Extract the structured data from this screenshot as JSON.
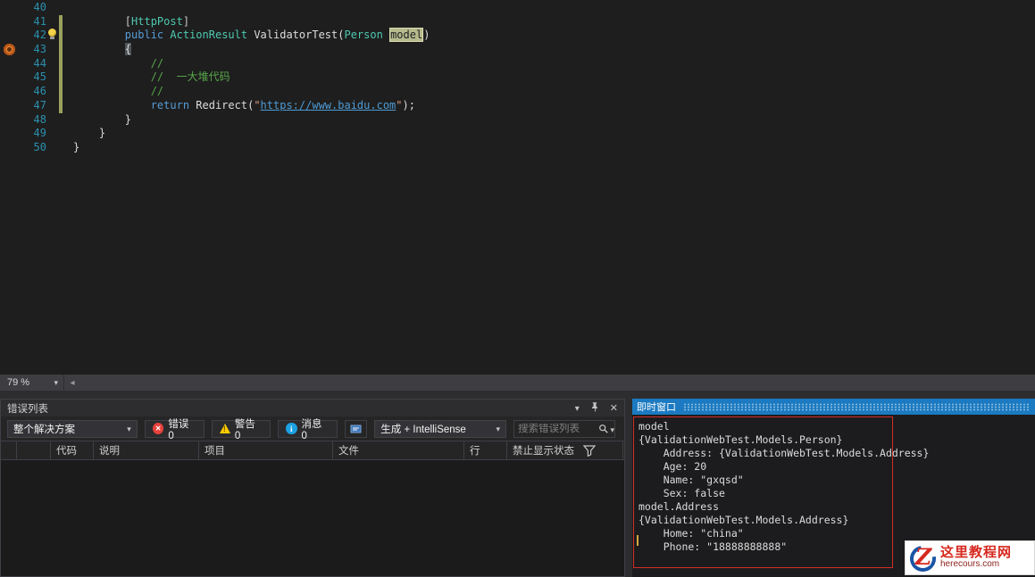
{
  "colors": {
    "accent_blue": "#1b7ac1",
    "annotation_red": "#d22d26",
    "error_red": "#e8413c",
    "warning_yellow": "#ffcc00",
    "info_blue": "#1ba1e2",
    "watermark_red": "#d6281e",
    "line_number_blue": "#2b91af",
    "keyword_blue": "#569cd6",
    "type_teal": "#4ec9b0",
    "comment_green": "#57a64a",
    "string_orange": "#d69d85"
  },
  "editor": {
    "zoom_label": "79 %",
    "lines": [
      {
        "num": "40",
        "indent": 0,
        "tokens": []
      },
      {
        "num": "41",
        "indent": 8,
        "tokens": [
          {
            "t": "punct",
            "s": "["
          },
          {
            "t": "type",
            "s": "HttpPost"
          },
          {
            "t": "punct",
            "s": "]"
          }
        ]
      },
      {
        "num": "42",
        "indent": 8,
        "tokens": [
          {
            "t": "kw",
            "s": "public"
          },
          {
            "t": "plain",
            "s": " "
          },
          {
            "t": "type",
            "s": "ActionResult"
          },
          {
            "t": "plain",
            "s": " ValidatorTest("
          },
          {
            "t": "type",
            "s": "Person"
          },
          {
            "t": "plain",
            "s": " "
          },
          {
            "t": "hl",
            "s": "model"
          },
          {
            "t": "plain",
            "s": ")"
          }
        ]
      },
      {
        "num": "43",
        "indent": 8,
        "tokens": [
          {
            "t": "bracehl",
            "s": "{"
          }
        ]
      },
      {
        "num": "44",
        "indent": 12,
        "tokens": [
          {
            "t": "comment",
            "s": "//"
          }
        ]
      },
      {
        "num": "45",
        "indent": 12,
        "tokens": [
          {
            "t": "comment",
            "s": "//  一大堆代码"
          }
        ]
      },
      {
        "num": "46",
        "indent": 12,
        "tokens": [
          {
            "t": "comment",
            "s": "//"
          }
        ]
      },
      {
        "num": "47",
        "indent": 12,
        "tokens": [
          {
            "t": "kw",
            "s": "return"
          },
          {
            "t": "plain",
            "s": " Redirect("
          },
          {
            "t": "str",
            "s": "\""
          },
          {
            "t": "link",
            "s": "https://www.baidu.com"
          },
          {
            "t": "str",
            "s": "\""
          },
          {
            "t": "plain",
            "s": ");"
          }
        ]
      },
      {
        "num": "48",
        "indent": 8,
        "tokens": [
          {
            "t": "plain",
            "s": "}"
          }
        ]
      },
      {
        "num": "49",
        "indent": 4,
        "tokens": [
          {
            "t": "plain",
            "s": "}"
          }
        ]
      },
      {
        "num": "50",
        "indent": 0,
        "tokens": [
          {
            "t": "plain",
            "s": "}"
          }
        ]
      }
    ]
  },
  "error_list": {
    "title": "错误列表",
    "scope_combo": "整个解决方案",
    "errors_button": "错误 0",
    "warnings_button": "警告 0",
    "messages_button": "消息 0",
    "filter_combo": "生成 + IntelliSense",
    "search_placeholder": "搜索错误列表",
    "columns": [
      "代码",
      "说明",
      "项目",
      "文件",
      "行",
      "禁止显示状态"
    ]
  },
  "immediate": {
    "title": "即时窗口",
    "lines": [
      "model",
      "{ValidationWebTest.Models.Person}",
      "    Address: {ValidationWebTest.Models.Address}",
      "    Age: 20",
      "    Name: \"gxqsd\"",
      "    Sex: false",
      "model.Address",
      "{ValidationWebTest.Models.Address}",
      "    Home: \"china\"",
      "    Phone: \"18888888888\""
    ]
  },
  "watermark": {
    "logo_text": "Z",
    "site_name": "这里教程网",
    "site_url": "herecours.com"
  }
}
